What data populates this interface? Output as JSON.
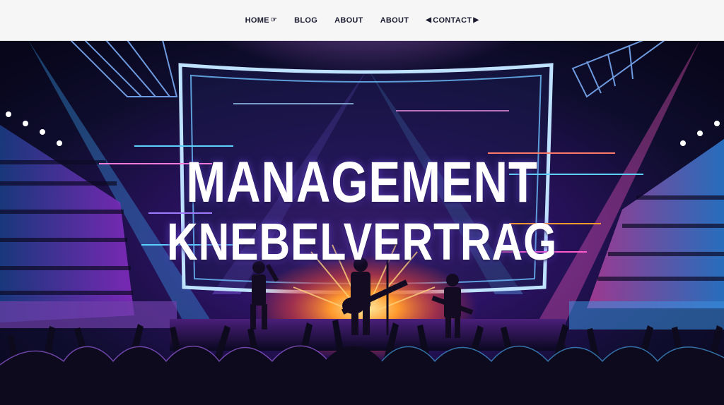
{
  "nav": {
    "items": [
      {
        "label": "HOME",
        "icon": "hand-pointer-icon",
        "icon_side": "right"
      },
      {
        "label": "BLOG"
      },
      {
        "label": "ABOUT"
      },
      {
        "label": "ABOUT"
      },
      {
        "label": "CONTACT",
        "icon": "bracket-arrows-icon",
        "icon_side": "both"
      }
    ]
  },
  "hero": {
    "title_line1": "MANAGEMENT",
    "title_line2": "KNEBELVERTRAG",
    "scene": "concert-arena-illustration"
  },
  "colors": {
    "nav_bg": "#f6f6f6",
    "nav_text": "#1b1b2f",
    "accent_blue": "#3fa9ff",
    "accent_purple": "#a04dff",
    "accent_orange": "#ff9a2e",
    "hero_bg": "#0b0a1e"
  }
}
